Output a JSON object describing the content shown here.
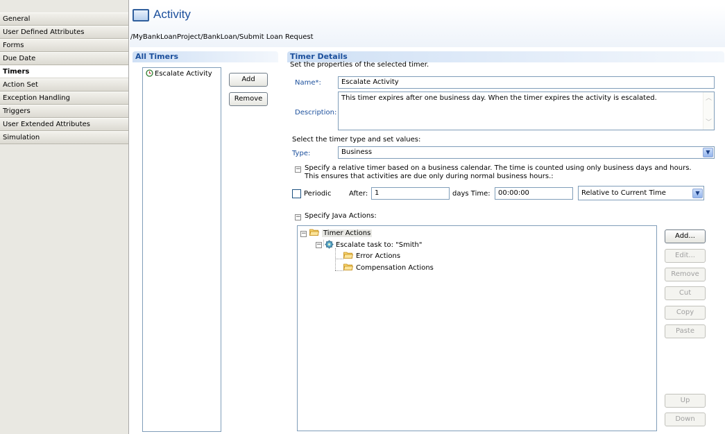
{
  "nav": {
    "items": [
      {
        "label": "General"
      },
      {
        "label": "User Defined Attributes"
      },
      {
        "label": "Forms"
      },
      {
        "label": "Due Date"
      },
      {
        "label": "Timers"
      },
      {
        "label": "Action Set"
      },
      {
        "label": "Exception Handling"
      },
      {
        "label": "Triggers"
      },
      {
        "label": "User Extended Attributes"
      },
      {
        "label": "Simulation"
      }
    ],
    "active": "Timers"
  },
  "header": {
    "title": "Activity",
    "breadcrumb": "/MyBankLoanProject/BankLoan/Submit Loan Request"
  },
  "all_timers": {
    "heading": "All Timers",
    "items": [
      "Escalate Activity"
    ],
    "add_label": "Add",
    "remove_label": "Remove"
  },
  "details": {
    "heading": "Timer Details",
    "intro": "Set the properties of the selected timer.",
    "name_label": "Name*:",
    "name_value": "Escalate Activity",
    "description_label": "Description:",
    "description_value": "This timer expires after one business day. When the timer expires the activity is escalated.",
    "select_type_text": "Select the timer type and set values:",
    "type_label": "Type:",
    "type_value": "Business",
    "relative_text_line1": "Specify a relative timer based on a business calendar. The time is counted using only business days and hours.",
    "relative_text_line2": "This ensures that activities are due only during normal business hours.:",
    "periodic_label": "Periodic",
    "periodic_checked": false,
    "after_label": "After:",
    "after_value": "1",
    "days_time_label": "days Time:",
    "time_value": "00:00:00",
    "relative_to_value": "Relative to Current Time",
    "java_actions_label": "Specify Java Actions:",
    "tree": {
      "root": "Timer Actions",
      "child": "Escalate task to: \"Smith\"",
      "grandchildren": [
        "Error Actions",
        "Compensation Actions"
      ]
    },
    "actions": {
      "add": "Add...",
      "edit": "Edit...",
      "remove": "Remove",
      "cut": "Cut",
      "copy": "Copy",
      "paste": "Paste",
      "up": "Up",
      "down": "Down"
    }
  },
  "colors": {
    "heading_blue": "#1b4f9c",
    "nav_bg": "#e9e8e2",
    "border_blue": "#7f9db9"
  }
}
